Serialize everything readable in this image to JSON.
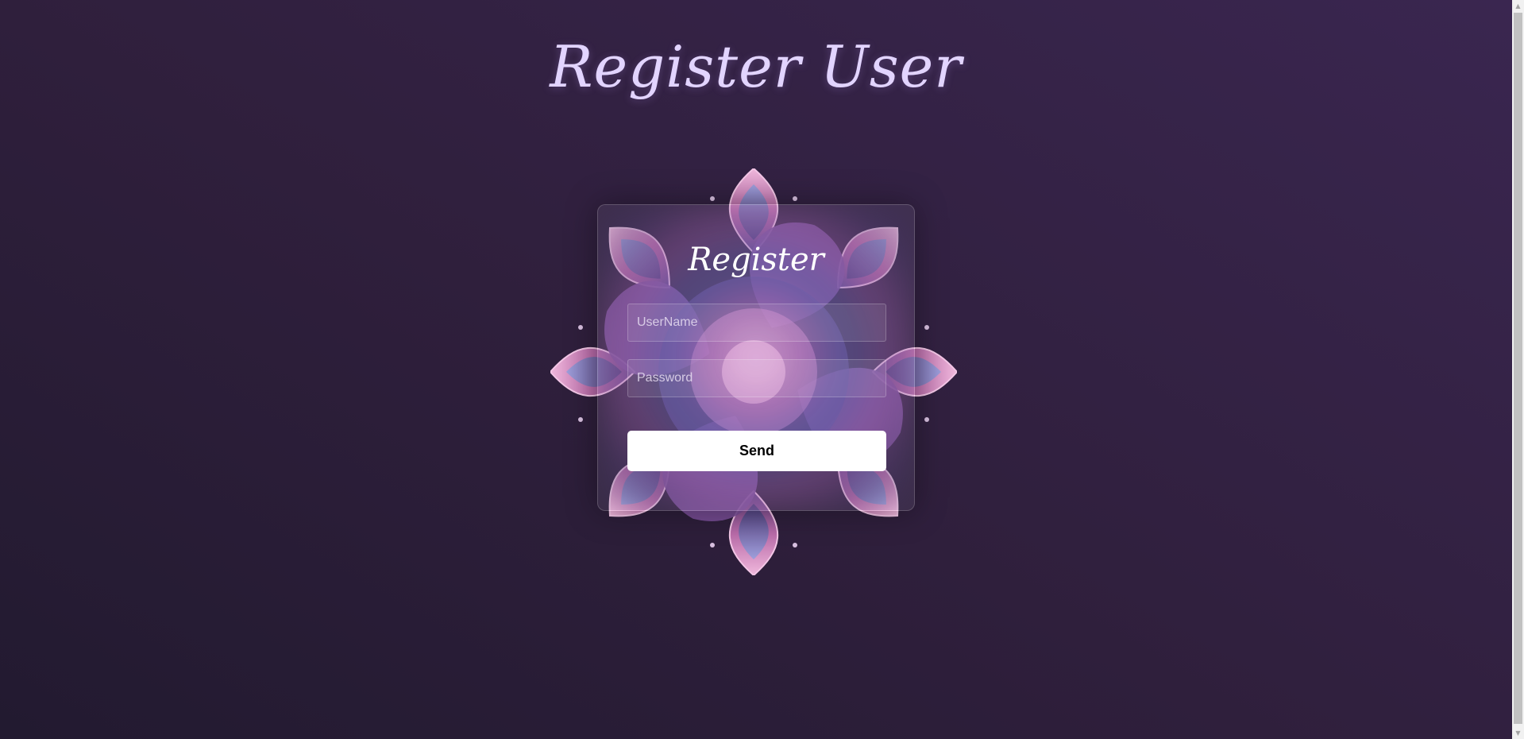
{
  "page": {
    "title": "Register User"
  },
  "form": {
    "title": "Register",
    "username_placeholder": "UserName",
    "password_placeholder": "Password",
    "send_label": "Send"
  },
  "colors": {
    "background": "#2f1f3c",
    "title": "#e2d4ff",
    "button_bg": "#ffffff",
    "button_text": "#000000"
  },
  "icons": {
    "scroll_up": "▲",
    "scroll_down": "▼"
  }
}
